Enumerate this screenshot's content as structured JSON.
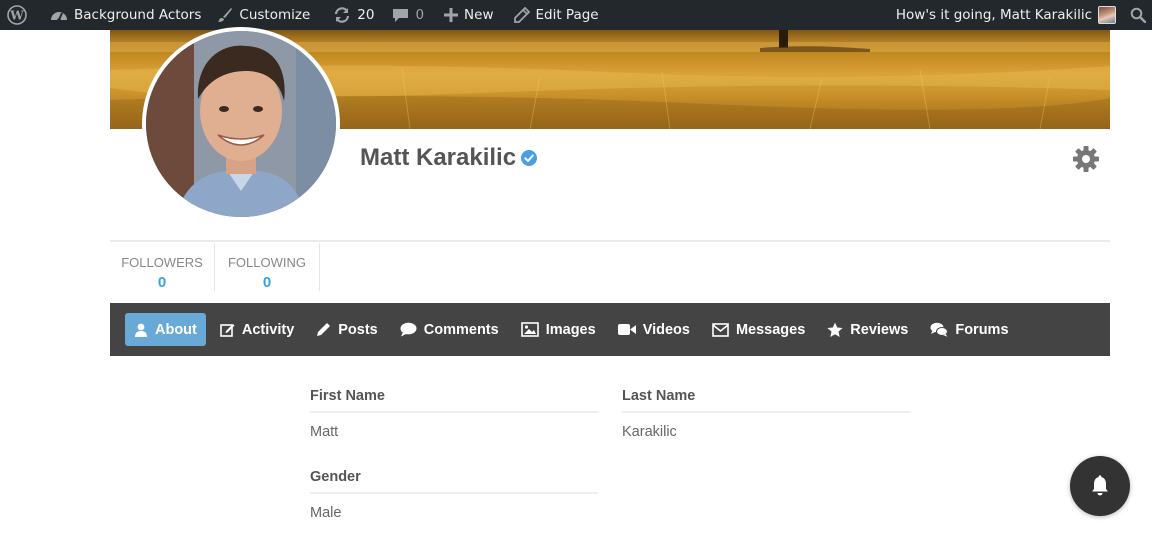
{
  "adminbar": {
    "site_name": "Background Actors",
    "customize": "Customize",
    "updates_count": "20",
    "comments_count": "0",
    "new_label": "New",
    "edit_page": "Edit Page",
    "greeting": "How's it going, Matt Karakilic"
  },
  "profile": {
    "name": "Matt Karakilic",
    "verified": true,
    "stats": [
      {
        "label": "FOLLOWERS",
        "value": "0"
      },
      {
        "label": "FOLLOWING",
        "value": "0"
      }
    ]
  },
  "nav": {
    "active": "About",
    "items": [
      {
        "label": "About",
        "icon": "user-icon"
      },
      {
        "label": "Activity",
        "icon": "edit-icon"
      },
      {
        "label": "Posts",
        "icon": "pencil-icon"
      },
      {
        "label": "Comments",
        "icon": "comment-icon"
      },
      {
        "label": "Images",
        "icon": "image-icon"
      },
      {
        "label": "Videos",
        "icon": "video-icon"
      },
      {
        "label": "Messages",
        "icon": "envelope-icon"
      },
      {
        "label": "Reviews",
        "icon": "star-icon"
      },
      {
        "label": "Forums",
        "icon": "comments-icon"
      }
    ]
  },
  "about": {
    "first_name_label": "First Name",
    "first_name_value": "Matt",
    "last_name_label": "Last Name",
    "last_name_value": "Karakilic",
    "gender_label": "Gender",
    "gender_value": "Male"
  },
  "colors": {
    "adminbar_bg": "#23282d",
    "navbar_bg": "#444444",
    "active_tab_bg": "#69a9d8",
    "stat_value": "#3ba1da",
    "verified_badge": "#4a9ee8"
  }
}
